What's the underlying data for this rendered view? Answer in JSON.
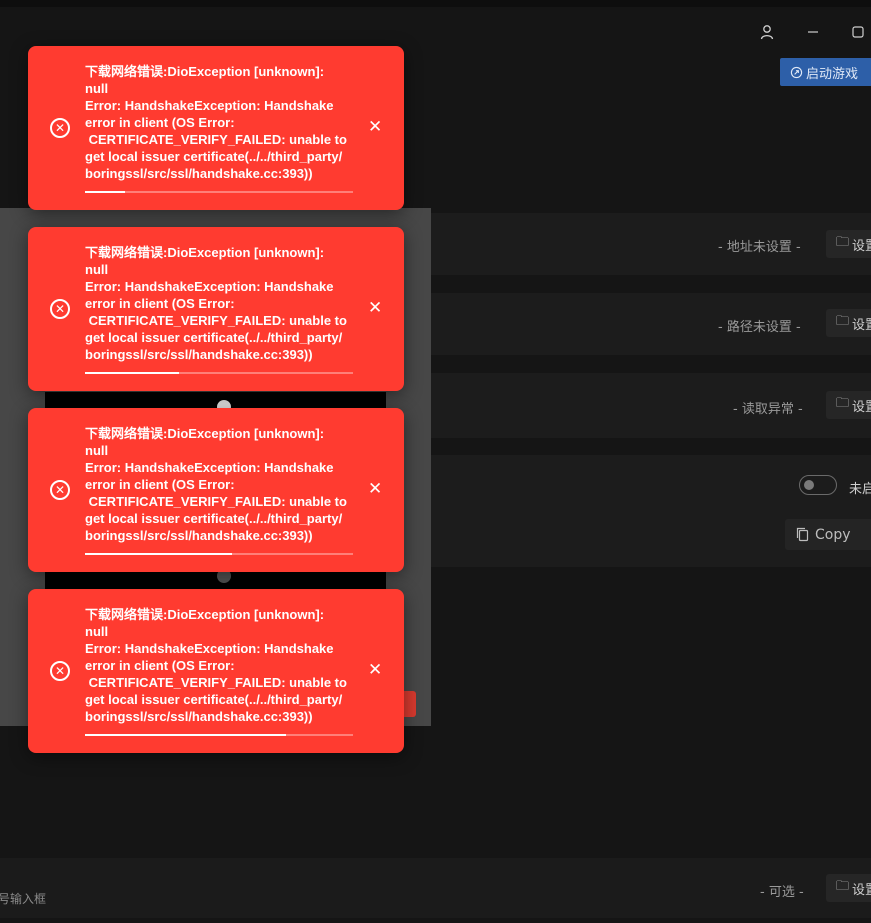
{
  "window": {
    "controls": [
      {
        "name": "user-icon",
        "glyph": "♙"
      },
      {
        "name": "minimize-icon",
        "glyph": "─"
      },
      {
        "name": "maximize-icon",
        "glyph": "▢"
      }
    ]
  },
  "header": {
    "launch_button": "启动游戏"
  },
  "settings_rows": [
    {
      "status": "- 地址未设置 -",
      "button": "设置"
    },
    {
      "status": "- 路径未设置 -",
      "button": "设置"
    },
    {
      "status": "- 读取异常 -",
      "button": "设置"
    }
  ],
  "toggle": {
    "label": "未启",
    "enabled": false
  },
  "copy_button": {
    "label": "Copy"
  },
  "bottom_row": {
    "input_hint": "号输入框",
    "status": "- 可选 -",
    "button": "设置"
  },
  "toasts": [
    {
      "text": "下载网络错误:DioException [unknown]:\nnull\nError: HandshakeException: Handshake\nerror in client (OS Error:\n CERTIFICATE_VERIFY_FAILED: unable to\nget local issuer certificate(../../third_party/\nboringssl/src/ssl/handshake.cc:393))",
      "progress": 0.15
    },
    {
      "text": "下载网络错误:DioException [unknown]:\nnull\nError: HandshakeException: Handshake\nerror in client (OS Error:\n CERTIFICATE_VERIFY_FAILED: unable to\nget local issuer certificate(../../third_party/\nboringssl/src/ssl/handshake.cc:393))",
      "progress": 0.35
    },
    {
      "text": "下载网络错误:DioException [unknown]:\nnull\nError: HandshakeException: Handshake\nerror in client (OS Error:\n CERTIFICATE_VERIFY_FAILED: unable to\nget local issuer certificate(../../third_party/\nboringssl/src/ssl/handshake.cc:393))",
      "progress": 0.55
    },
    {
      "text": "下载网络错误:DioException [unknown]:\nnull\nError: HandshakeException: Handshake\nerror in client (OS Error:\n CERTIFICATE_VERIFY_FAILED: unable to\nget local issuer certificate(../../third_party/\nboringssl/src/ssl/handshake.cc:393))",
      "progress": 0.75
    }
  ],
  "colors": {
    "toast_bg": "#ff3b30",
    "launch_bg": "#2d5fa8",
    "background": "#151515"
  }
}
